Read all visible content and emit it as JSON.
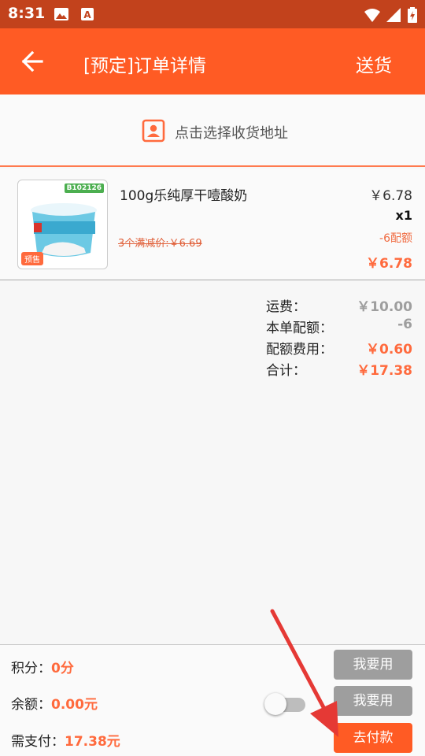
{
  "status_bar": {
    "time": "8:31",
    "icons": [
      "gallery-icon",
      "text-a-icon",
      "wifi-icon",
      "signal-icon",
      "battery-icon"
    ]
  },
  "app_bar": {
    "title": "[预定]订单详情",
    "action_label": "送货",
    "back_icon": "arrow-left-icon"
  },
  "address": {
    "label": "点击选择收货地址",
    "icon": "contact-card-icon"
  },
  "product": {
    "name": "100g乐纯厚干噎酸奶",
    "code_badge": "B102126",
    "presale_tag": "预售",
    "promo_text": "3个满减价:￥6.69",
    "price": "￥6.78",
    "quantity": "x1",
    "quota": "-6配额",
    "final_price": "￥6.78"
  },
  "summary": {
    "rows": [
      {
        "label": "运费：",
        "value": "￥10.00"
      },
      {
        "label": "本单配额：",
        "value": "-6"
      },
      {
        "label": "配额费用：",
        "value": "￥0.60"
      },
      {
        "label": "合计：",
        "value": "￥17.38"
      }
    ]
  },
  "payment": {
    "points_label": "积分：",
    "points_value": "0分",
    "balance_label": "余额：",
    "balance_value": "0.00元",
    "due_label": "需支付：",
    "due_value": "17.38元",
    "use_points_button": "我要用",
    "use_balance_button": "我要用",
    "pay_button": "去付款",
    "balance_toggle_on": false
  },
  "colors": {
    "status_bar": "#c2421c",
    "app_bar": "#ff5b24",
    "accent": "#ff6a3d",
    "muted_button": "#9e9e9e",
    "annotation_arrow": "#e53935"
  }
}
